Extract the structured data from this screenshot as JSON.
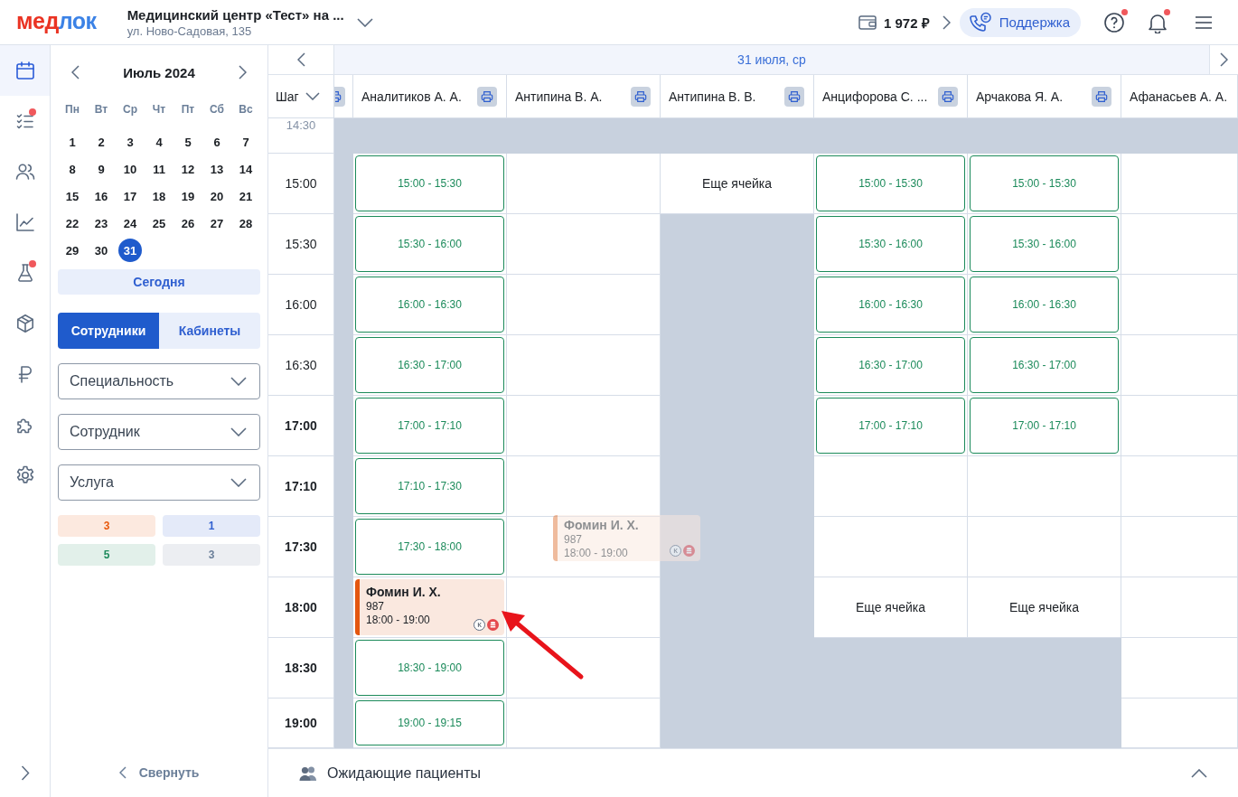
{
  "topbar": {
    "logo": [
      {
        "text": "мед",
        "color": "#ea3323"
      },
      {
        "text": "лок",
        "color": "#3b82e6"
      }
    ],
    "clinic": {
      "name": "Медицинский центр «Тест» на ...",
      "address": "ул. Ново-Садовая, 135"
    },
    "balance": "1 972 ₽",
    "support_button": "Поддержка",
    "help_notification": true,
    "bell_notification": true
  },
  "rail": {
    "items": [
      {
        "selected": true,
        "notification": false
      },
      {
        "selected": false,
        "notification": true
      },
      {
        "selected": false,
        "notification": false
      },
      {
        "selected": false,
        "notification": false
      },
      {
        "selected": false,
        "notification": true
      },
      {
        "selected": false,
        "notification": false
      },
      {
        "selected": false,
        "notification": false
      },
      {
        "selected": false,
        "notification": false
      },
      {
        "selected": false,
        "notification": false
      }
    ]
  },
  "calendar": {
    "month": "Июль 2024",
    "weekdays": [
      "Пн",
      "Вт",
      "Ср",
      "Чт",
      "Пт",
      "Сб",
      "Вс"
    ],
    "days": [
      {
        "day": "1",
        "selected": false
      },
      {
        "day": "2",
        "selected": false
      },
      {
        "day": "3",
        "selected": false
      },
      {
        "day": "4",
        "selected": false
      },
      {
        "day": "5",
        "selected": false
      },
      {
        "day": "6",
        "selected": false
      },
      {
        "day": "7",
        "selected": false
      },
      {
        "day": "8",
        "selected": false
      },
      {
        "day": "9",
        "selected": false
      },
      {
        "day": "10",
        "selected": false
      },
      {
        "day": "11",
        "selected": false
      },
      {
        "day": "12",
        "selected": false
      },
      {
        "day": "13",
        "selected": false
      },
      {
        "day": "14",
        "selected": false
      },
      {
        "day": "15",
        "selected": false
      },
      {
        "day": "16",
        "selected": false
      },
      {
        "day": "17",
        "selected": false
      },
      {
        "day": "18",
        "selected": false
      },
      {
        "day": "19",
        "selected": false
      },
      {
        "day": "20",
        "selected": false
      },
      {
        "day": "21",
        "selected": false
      },
      {
        "day": "22",
        "selected": false
      },
      {
        "day": "23",
        "selected": false
      },
      {
        "day": "24",
        "selected": false
      },
      {
        "day": "25",
        "selected": false
      },
      {
        "day": "26",
        "selected": false
      },
      {
        "day": "27",
        "selected": false
      },
      {
        "day": "28",
        "selected": false
      },
      {
        "day": "29",
        "selected": false
      },
      {
        "day": "30",
        "selected": false
      },
      {
        "day": "31",
        "selected": true
      }
    ],
    "today_button": "Сегодня"
  },
  "view_switch": [
    {
      "label": "Сотрудники",
      "selected": true
    },
    {
      "label": "Кабинеты",
      "selected": false
    }
  ],
  "filters": [
    {
      "placeholder": "Специальность"
    },
    {
      "placeholder": "Сотрудник"
    },
    {
      "placeholder": "Услуга"
    }
  ],
  "counters": [
    {
      "value": "3",
      "color": "#e8590c"
    },
    {
      "value": "1",
      "color": "#2f5fd0"
    },
    {
      "value": "5",
      "color": "#1e8a5c"
    },
    {
      "value": "3",
      "color": "#6b7f99"
    }
  ],
  "collapse_button": "Свернуть",
  "schedule": {
    "date": "31 июля, ср",
    "step_label": "Шаг",
    "columns": [
      {
        "kind": "cut",
        "print_button": true
      },
      {
        "kind": "full",
        "name": "Аналитиков А. А.",
        "print_button": true
      },
      {
        "kind": "full",
        "name": "Антипина В. А.",
        "print_button": true
      },
      {
        "kind": "full",
        "name": "Антипина В. В.",
        "print_button": true
      },
      {
        "kind": "full",
        "name": "Анцифорова С. ...",
        "print_button": true
      },
      {
        "kind": "full",
        "name": "Арчакова Я. А.",
        "print_button": true
      },
      {
        "kind": "full",
        "name": "Афанасьев А. А.",
        "print_button": false
      }
    ],
    "rows": [
      {
        "time": "14:30",
        "kind": "faded",
        "cells": [
          {
            "kind": "off"
          },
          {
            "kind": "off"
          },
          {
            "kind": "off"
          },
          {
            "kind": "off"
          },
          {
            "kind": "off"
          },
          {
            "kind": "off"
          },
          {
            "kind": "off"
          }
        ]
      },
      {
        "time": "15:00",
        "kind": "normal",
        "cells": [
          {
            "kind": "off"
          },
          {
            "kind": "slot",
            "text": "15:00 - 15:30"
          },
          {
            "kind": "empty"
          },
          {
            "kind": "more",
            "text": "Еще ячейка"
          },
          {
            "kind": "slot",
            "text": "15:00 - 15:30"
          },
          {
            "kind": "slot",
            "text": "15:00 - 15:30"
          },
          {
            "kind": "empty"
          }
        ]
      },
      {
        "time": "15:30",
        "kind": "normal",
        "cells": [
          {
            "kind": "off"
          },
          {
            "kind": "slot",
            "text": "15:30 - 16:00"
          },
          {
            "kind": "empty"
          },
          {
            "kind": "off"
          },
          {
            "kind": "slot",
            "text": "15:30 - 16:00"
          },
          {
            "kind": "slot",
            "text": "15:30 - 16:00"
          },
          {
            "kind": "empty"
          }
        ]
      },
      {
        "time": "16:00",
        "kind": "normal",
        "cells": [
          {
            "kind": "off"
          },
          {
            "kind": "slot",
            "text": "16:00 - 16:30"
          },
          {
            "kind": "empty"
          },
          {
            "kind": "off"
          },
          {
            "kind": "slot",
            "text": "16:00 - 16:30"
          },
          {
            "kind": "slot",
            "text": "16:00 - 16:30"
          },
          {
            "kind": "empty"
          }
        ]
      },
      {
        "time": "16:30",
        "kind": "normal",
        "cells": [
          {
            "kind": "off"
          },
          {
            "kind": "slot",
            "text": "16:30 - 17:00"
          },
          {
            "kind": "empty"
          },
          {
            "kind": "off"
          },
          {
            "kind": "slot",
            "text": "16:30 - 17:00"
          },
          {
            "kind": "slot",
            "text": "16:30 - 17:00"
          },
          {
            "kind": "empty"
          }
        ]
      },
      {
        "time": "17:00",
        "kind": "bold",
        "cells": [
          {
            "kind": "off"
          },
          {
            "kind": "slot",
            "text": "17:00 - 17:10"
          },
          {
            "kind": "empty"
          },
          {
            "kind": "off"
          },
          {
            "kind": "slot",
            "text": "17:00 - 17:10"
          },
          {
            "kind": "slot",
            "text": "17:00 - 17:10"
          },
          {
            "kind": "empty"
          }
        ]
      },
      {
        "time": "17:10",
        "kind": "bold",
        "cells": [
          {
            "kind": "off"
          },
          {
            "kind": "slot",
            "text": "17:10 - 17:30"
          },
          {
            "kind": "empty"
          },
          {
            "kind": "off"
          },
          {
            "kind": "empty"
          },
          {
            "kind": "empty"
          },
          {
            "kind": "empty"
          }
        ]
      },
      {
        "time": "17:30",
        "kind": "bold",
        "cells": [
          {
            "kind": "off"
          },
          {
            "kind": "slot",
            "text": "17:30 - 18:00"
          },
          {
            "kind": "empty"
          },
          {
            "kind": "off"
          },
          {
            "kind": "empty"
          },
          {
            "kind": "empty"
          },
          {
            "kind": "empty"
          }
        ]
      },
      {
        "time": "18:00",
        "kind": "bold",
        "cells": [
          {
            "kind": "off"
          },
          {
            "kind": "appointment",
            "patient": "Фомин И. Х.",
            "number": "987",
            "time": "18:00 - 19:00",
            "badge": "К"
          },
          {
            "kind": "empty"
          },
          {
            "kind": "off"
          },
          {
            "kind": "more",
            "text": "Еще ячейка"
          },
          {
            "kind": "more",
            "text": "Еще ячейка"
          },
          {
            "kind": "empty"
          }
        ]
      },
      {
        "time": "18:30",
        "kind": "bold",
        "cells": [
          {
            "kind": "off"
          },
          {
            "kind": "slot",
            "text": "18:30 - 19:00"
          },
          {
            "kind": "empty"
          },
          {
            "kind": "off"
          },
          {
            "kind": "off"
          },
          {
            "kind": "off"
          },
          {
            "kind": "empty"
          }
        ]
      },
      {
        "time": "19:00",
        "kind": "bold",
        "cells": [
          {
            "kind": "off"
          },
          {
            "kind": "slot",
            "text": "19:00 - 19:15"
          },
          {
            "kind": "empty"
          },
          {
            "kind": "off"
          },
          {
            "kind": "off"
          },
          {
            "kind": "off"
          },
          {
            "kind": "empty"
          }
        ]
      }
    ],
    "drag_preview": {
      "patient": "Фомин И. Х.",
      "number": "987",
      "time": "18:00 - 19:00",
      "badge": "К"
    }
  },
  "waiting_panel": {
    "title": "Ожидающие пациенты",
    "expanded": false
  }
}
